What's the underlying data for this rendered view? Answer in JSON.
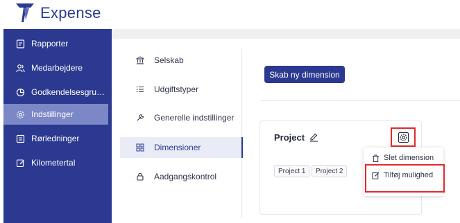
{
  "app": {
    "name": "Expense"
  },
  "sidebar": {
    "items": [
      {
        "label": "Rapporter",
        "icon": "report-icon"
      },
      {
        "label": "Medarbejdere",
        "icon": "users-icon"
      },
      {
        "label": "Godkendelsesgrupp...",
        "icon": "pie-chart-icon"
      },
      {
        "label": "Indstillinger",
        "icon": "gear-icon",
        "active": true
      },
      {
        "label": "Rørledninger",
        "icon": "pipeline-icon"
      },
      {
        "label": "Kilometertal",
        "icon": "edit-icon"
      }
    ]
  },
  "submenu": {
    "items": [
      {
        "label": "Selskab",
        "icon": "bank-icon"
      },
      {
        "label": "Udgiftstyper",
        "icon": "list-icon"
      },
      {
        "label": "Generelle indstillinger",
        "icon": "wrench-icon"
      },
      {
        "label": "Dimensioner",
        "icon": "dimensions-icon",
        "active": true
      },
      {
        "label": "Aadgangskontrol",
        "icon": "lock-icon"
      }
    ]
  },
  "main": {
    "create_button": "Skab ny dimension",
    "card": {
      "title": "Project",
      "options": [
        "Project 1",
        "Project 2"
      ]
    },
    "context_menu": {
      "items": [
        "Slet dimension",
        "Tilføj mulighed"
      ]
    }
  },
  "colors": {
    "brand": "#2b3990",
    "sidebar_active": "#7b87c6",
    "highlight": "#e5262b"
  }
}
